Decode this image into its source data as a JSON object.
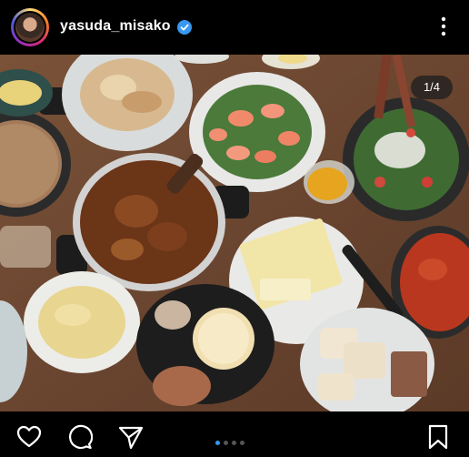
{
  "header": {
    "username": "yasuda_misako",
    "verified_icon": "verified-badge-icon",
    "more_icon": "more-vertical-icon"
  },
  "post": {
    "counter": "1/4",
    "image_type": "photo"
  },
  "footer": {
    "icons": [
      "heart-icon",
      "comment-icon",
      "share-icon",
      "bookmark-icon"
    ],
    "carousel_dots": 4,
    "carousel_active_index": 0
  },
  "colors": {
    "accent": "#3897f0",
    "background": "#000000"
  }
}
